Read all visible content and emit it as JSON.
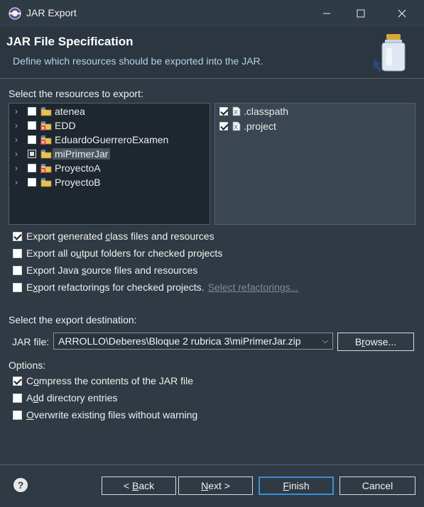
{
  "window": {
    "title": "JAR Export"
  },
  "header": {
    "title": "JAR File Specification",
    "description": "Define which resources should be exported into the JAR."
  },
  "resources": {
    "label": "Select the resources to export:",
    "projects": [
      {
        "name": "atenea",
        "checked": false,
        "error": false
      },
      {
        "name": "EDD",
        "checked": false,
        "error": true
      },
      {
        "name": "EduardoGuerreroExamen",
        "checked": false,
        "error": true
      },
      {
        "name": "miPrimerJar",
        "checked": "partial",
        "error": false,
        "selected": true
      },
      {
        "name": "ProyectoA",
        "checked": false,
        "error": true
      },
      {
        "name": "ProyectoB",
        "checked": false,
        "error": false
      }
    ],
    "files": [
      {
        "name": ".classpath",
        "checked": true
      },
      {
        "name": ".project",
        "checked": true
      }
    ]
  },
  "export_options": {
    "class_files": {
      "pre": "Export generated ",
      "ul": "c",
      "post": "lass files and resources",
      "checked": true
    },
    "output_folders": {
      "pre": "Export all o",
      "ul": "u",
      "post": "tput folders for checked projects",
      "checked": false
    },
    "java_source": {
      "pre": "Export Java ",
      "ul": "s",
      "post": "ource files and resources",
      "checked": false
    },
    "refactorings": {
      "pre": "E",
      "ul": "x",
      "post": "port refactorings for checked projects.",
      "checked": false
    },
    "select_refactorings": "Select refactorings..."
  },
  "destination": {
    "label": "Select the export destination:",
    "jar_file_label": "JAR file:",
    "jar_file_value": "ARROLLO\\Deberes\\Bloque 2 rubrica 3\\miPrimerJar.zip",
    "browse_pre": "B",
    "browse_ul": "r",
    "browse_post": "owse..."
  },
  "options": {
    "label": "Options:",
    "compress": {
      "pre": "C",
      "ul": "o",
      "post": "mpress the contents of the JAR file",
      "checked": true
    },
    "directory_entries": {
      "pre": "A",
      "ul": "d",
      "post": "d directory entries",
      "checked": false
    },
    "overwrite": {
      "pre": "",
      "ul": "O",
      "post": "verwrite existing files without warning",
      "checked": false
    }
  },
  "buttons": {
    "back_pre": "< ",
    "back_ul": "B",
    "back_post": "ack",
    "next_ul": "N",
    "next_post": "ext >",
    "finish_ul": "F",
    "finish_post": "inish",
    "cancel": "Cancel",
    "help": "?"
  },
  "colors": {
    "accent": "#3a8fd4",
    "background": "#2f3a44",
    "tree_bg": "#1e2730"
  }
}
